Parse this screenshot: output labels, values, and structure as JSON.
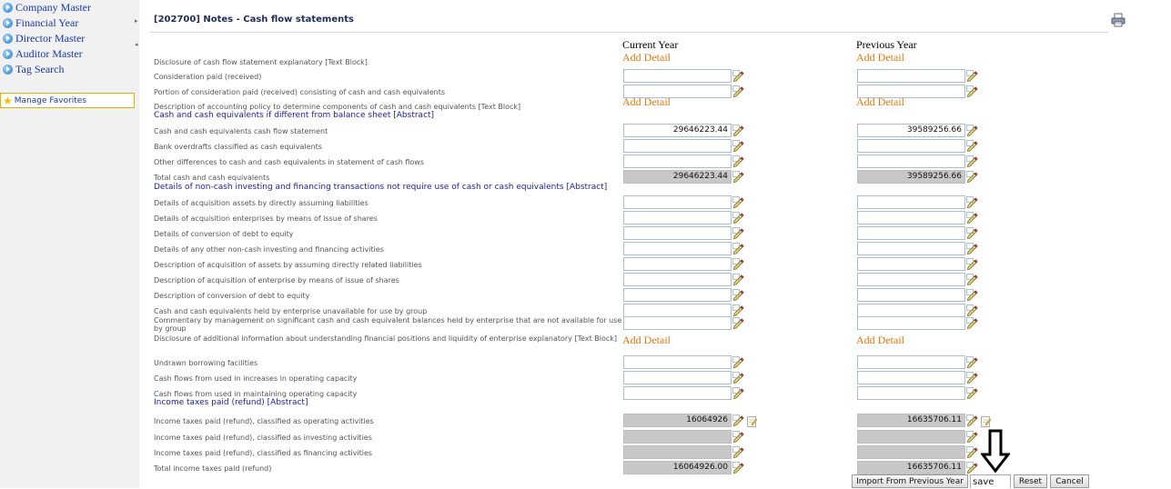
{
  "sidebar": {
    "items": [
      {
        "label": "Company Master",
        "icon": "arrow-bullet-icon"
      },
      {
        "label": "Financial Year",
        "icon": "arrow-bullet-icon"
      },
      {
        "label": "Director Master",
        "icon": "arrow-bullet-icon"
      },
      {
        "label": "Auditor Master",
        "icon": "arrow-bullet-icon"
      },
      {
        "label": "Tag Search",
        "icon": "arrow-bullet-icon"
      }
    ],
    "favorites": {
      "label": "Manage Favorites",
      "icon": "star-icon"
    }
  },
  "header": {
    "title": "[202700] Notes - Cash flow statements",
    "print_icon": "printer-icon"
  },
  "columns": {
    "current": "Current Year",
    "previous": "Previous Year"
  },
  "add_detail_label": "Add Detail",
  "rows": [
    {
      "label": "Disclosure of cash flow statement explanatory [Text Block]"
    },
    {
      "label": "Consideration paid (received)",
      "current": "",
      "previous": ""
    },
    {
      "label": "Portion of consideration paid (received) consisting of cash and cash equivalents",
      "current": "",
      "previous": ""
    },
    {
      "label": "Description of accounting policy to determine components of cash and cash equivalents [Text Block]"
    },
    {
      "label": "Cash and cash equivalents if different from balance sheet [Abstract]"
    },
    {
      "label": "Cash and cash equivalents cash flow statement",
      "current": "29646223.44",
      "previous": "39589256.66"
    },
    {
      "label": "Bank overdrafts classified as cash equivalents",
      "current": "",
      "previous": ""
    },
    {
      "label": "Other differences to cash and cash equivalents in statement of cash flows",
      "current": "",
      "previous": ""
    },
    {
      "label": "Total cash and cash equivalents",
      "current": "29646223.44",
      "previous": "39589256.66"
    },
    {
      "label": "Details of non-cash investing and financing transactions not require use of cash or cash equivalents [Abstract]"
    },
    {
      "label": "Details of acquisition assets by directly assuming liabilities",
      "current": "",
      "previous": ""
    },
    {
      "label": "Details of acquisition enterprises by means of issue of shares",
      "current": "",
      "previous": ""
    },
    {
      "label": "Details of conversion of debt to equity",
      "current": "",
      "previous": ""
    },
    {
      "label": "Details of any other non-cash investing and financing activities",
      "current": "",
      "previous": ""
    },
    {
      "label": "Description of acquisition of assets by assuming directly related liabilities",
      "current": "",
      "previous": ""
    },
    {
      "label": "Description of acquisition of enterprise by means of issue of shares",
      "current": "",
      "previous": ""
    },
    {
      "label": "Description of conversion of debt to equity",
      "current": "",
      "previous": ""
    },
    {
      "label": "Cash and cash equivalents held by enterprise unavailable for use by group",
      "current": "",
      "previous": ""
    },
    {
      "label": "Commentary by management on significant cash and cash equivalent balances held by enterprise that are not available for use by group",
      "current": "",
      "previous": ""
    },
    {
      "label": "Disclosure of additional information about understanding financial positions and liquidity of enterprise explanatory [Text Block]"
    },
    {
      "label": "Undrawn borrowing facilities",
      "current": "",
      "previous": ""
    },
    {
      "label": "Cash flows from used in increases in operating capacity",
      "current": "",
      "previous": ""
    },
    {
      "label": "Cash flows from used in maintaining operating capacity",
      "current": "",
      "previous": ""
    },
    {
      "label": "Income taxes paid (refund) [Abstract]"
    },
    {
      "label": "Income taxes paid (refund), classified as operating activities",
      "current": "16064926",
      "previous": "16635706.11"
    },
    {
      "label": "Income taxes paid (refund), classified as investing activities",
      "current": "",
      "previous": ""
    },
    {
      "label": "Income taxes paid (refund), classified as financing activities",
      "current": "",
      "previous": ""
    },
    {
      "label": "Total income taxes paid (refund)",
      "current": "16064926.00",
      "previous": "16635706.11"
    }
  ],
  "footer": {
    "import_label": "Import From Previous Year",
    "save_label": "save",
    "reset_label": "Reset",
    "cancel_label": "Cancel",
    "arrow_icon": "down-arrow-icon"
  },
  "colors": {
    "link": "#1a3aa8",
    "add_detail": "#e8750a",
    "section": "#2020a8",
    "readonly_field": "#c8c8c8"
  }
}
